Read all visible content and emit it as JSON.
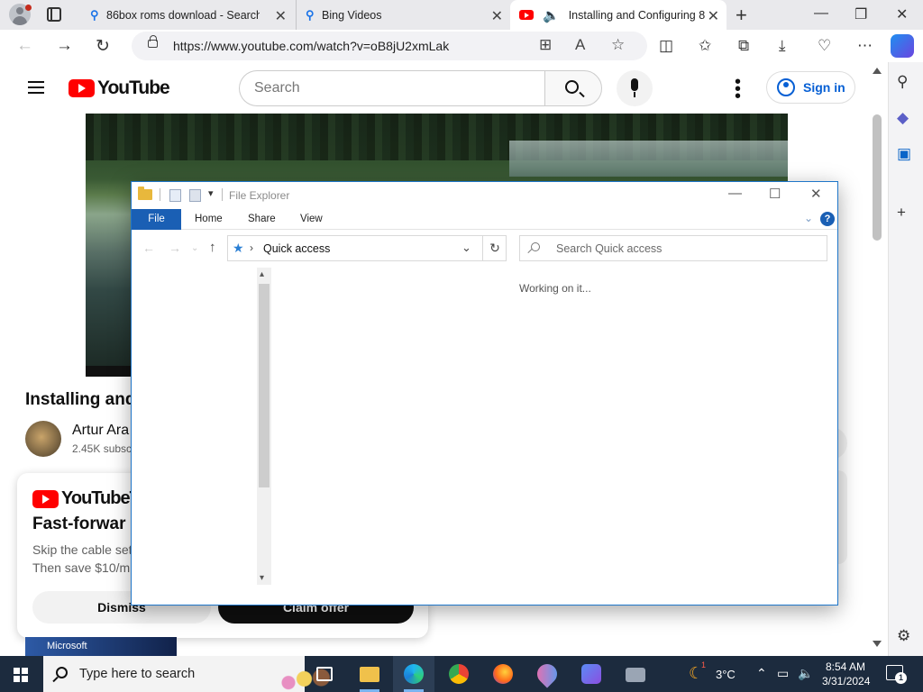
{
  "browser": {
    "tabs": [
      {
        "title": "86box roms download - Search",
        "icon": "search-icon"
      },
      {
        "title": "Bing Videos",
        "icon": "search-icon"
      },
      {
        "title": "Installing and Configuring 8",
        "icon": "youtube-icon",
        "audio": true,
        "active": true
      }
    ],
    "url": "https://www.youtube.com/watch?v=oB8jU2xmLak"
  },
  "youtube": {
    "logo_text": "YouTube",
    "search_placeholder": "Search",
    "sign_in": "Sign in",
    "video_title": "Installing and",
    "channel_name": "Artur Ara",
    "subscribers": "2.45K subsc",
    "promo": {
      "logo_text": "YouTubeTV",
      "headline": "Fast-forwar",
      "line1": "Skip the cable set",
      "line2": "Then save $10/m",
      "dismiss": "Dismiss",
      "claim": "Claim offer"
    },
    "thumb_text": "Microsoft"
  },
  "explorer": {
    "title": "File Explorer",
    "ribbon_tabs": [
      "File",
      "Home",
      "Share",
      "View"
    ],
    "location": "Quick access",
    "search_placeholder": "Search Quick access",
    "status": "Working on it...",
    "help": "?"
  },
  "taskbar": {
    "search_placeholder": "Type here to search",
    "weather": "3°C",
    "time": "8:54 AM",
    "date": "3/31/2024",
    "notifications": "1",
    "weather_badge": "1"
  },
  "colors": {
    "youtube_red": "#ff0000",
    "link_blue": "#065fd4",
    "explorer_blue": "#1a5fb4",
    "taskbar": "#1c2b3e"
  }
}
